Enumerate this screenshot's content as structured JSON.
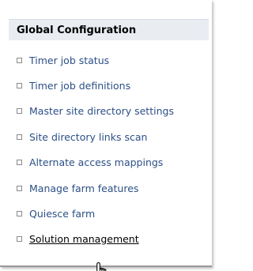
{
  "section": {
    "title": "Global Configuration"
  },
  "links": [
    {
      "label": "Timer job status"
    },
    {
      "label": "Timer job definitions"
    },
    {
      "label": "Master site directory settings"
    },
    {
      "label": "Site directory links scan"
    },
    {
      "label": "Alternate access mappings"
    },
    {
      "label": "Manage farm features"
    },
    {
      "label": "Quiesce farm"
    },
    {
      "label": "Solution management",
      "hovered": true
    }
  ],
  "icons": {
    "bullet": "square-bullet-icon",
    "cursor": "hand-pointer-icon"
  },
  "colors": {
    "header_background": "#e9edf2",
    "link": "#2c4f86",
    "hovered_link": "#000000"
  }
}
